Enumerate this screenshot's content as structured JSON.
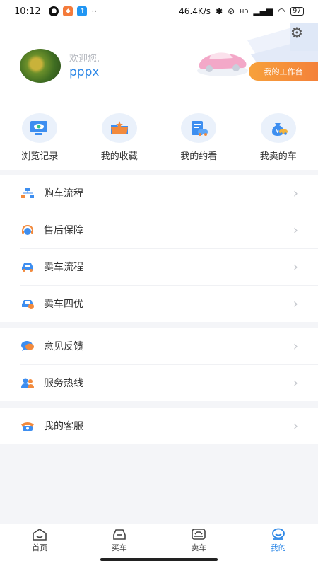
{
  "status": {
    "time": "10:12",
    "speed": "46.4K/s",
    "signal": "HD",
    "battery": "97"
  },
  "profile": {
    "welcome": "欢迎您,",
    "username": "pppx",
    "workbench_label": "我的工作台"
  },
  "quick_actions": [
    {
      "label": "浏览记录",
      "icon": "monitor-eye-icon"
    },
    {
      "label": "我的收藏",
      "icon": "folder-star-icon"
    },
    {
      "label": "我的约看",
      "icon": "document-car-icon"
    },
    {
      "label": "我卖的车",
      "icon": "money-bag-car-icon"
    }
  ],
  "sections": [
    {
      "items": [
        {
          "label": "购车流程",
          "icon": "flowchart-icon"
        },
        {
          "label": "售后保障",
          "icon": "headset-icon"
        },
        {
          "label": "卖车流程",
          "icon": "car-process-icon"
        },
        {
          "label": "卖车四优",
          "icon": "car-badge-icon"
        }
      ]
    },
    {
      "items": [
        {
          "label": "意见反馈",
          "icon": "chat-bubble-icon"
        },
        {
          "label": "服务热线",
          "icon": "people-icon"
        }
      ]
    },
    {
      "items": [
        {
          "label": "我的客服",
          "icon": "telephone-icon"
        }
      ]
    }
  ],
  "tabs": [
    {
      "label": "首页",
      "icon": "home-icon"
    },
    {
      "label": "买车",
      "icon": "buy-car-icon"
    },
    {
      "label": "卖车",
      "icon": "sell-car-icon"
    },
    {
      "label": "我的",
      "icon": "profile-icon",
      "active": true
    }
  ],
  "colors": {
    "accent": "#2b86e6",
    "orange": "#f4813a",
    "background": "#f4f5f8"
  }
}
